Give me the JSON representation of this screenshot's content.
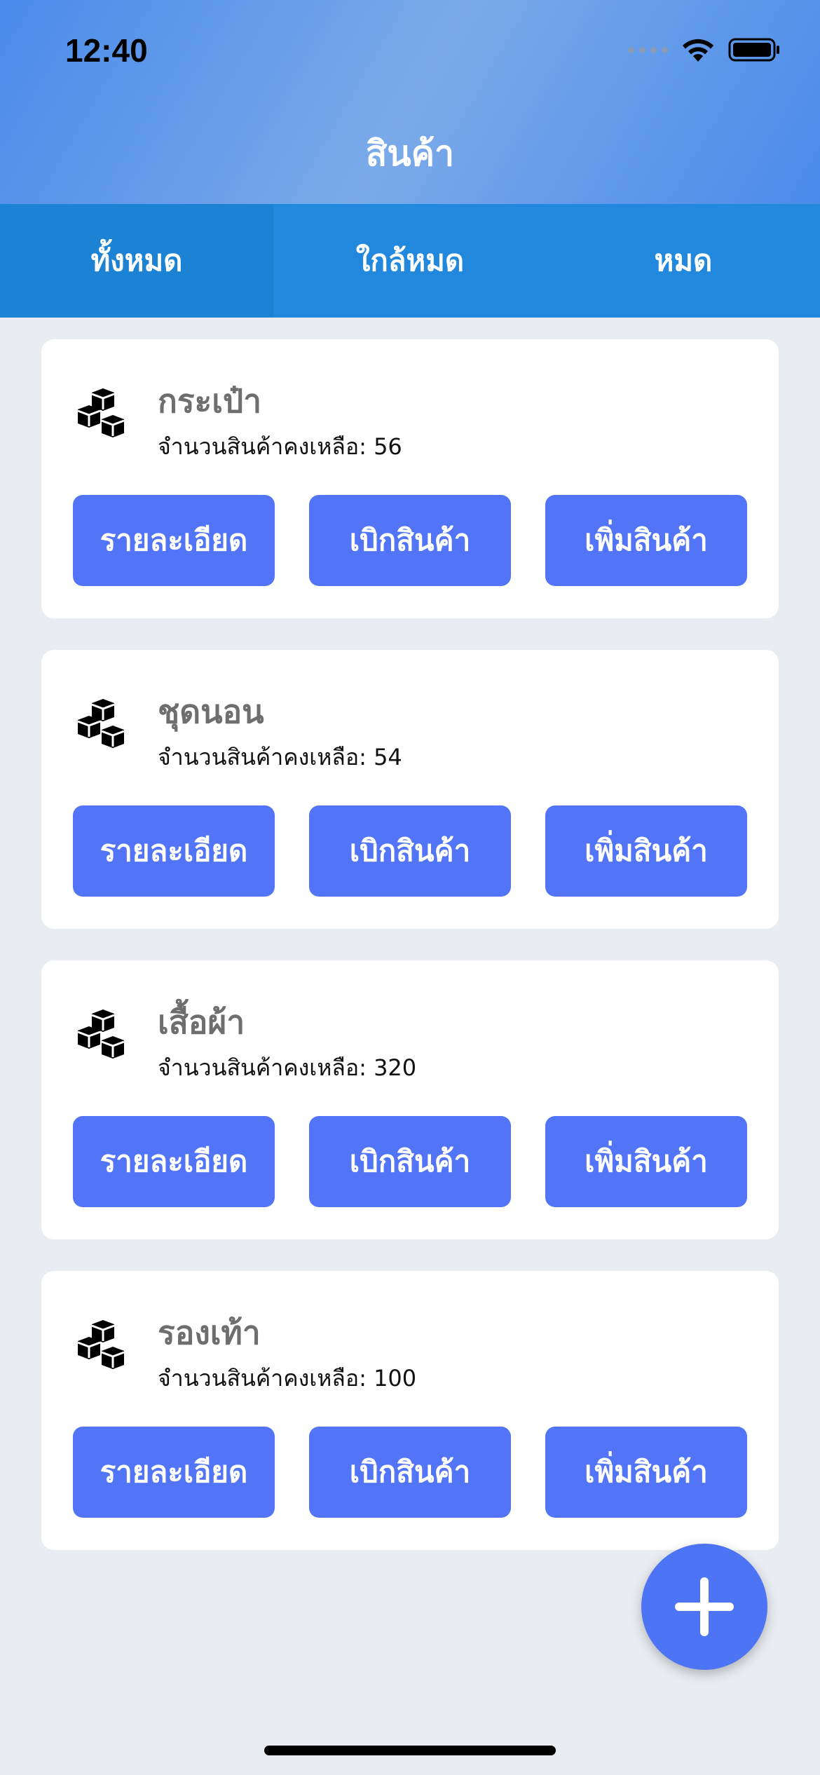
{
  "status_bar": {
    "time": "12:40"
  },
  "header": {
    "title": "สินค้า"
  },
  "tabs": [
    {
      "label": "ทั้งหมด",
      "active": true
    },
    {
      "label": "ใกล้หมด",
      "active": false
    },
    {
      "label": "หมด",
      "active": false
    }
  ],
  "products": [
    {
      "name": "กระเป๋า",
      "stock": "จำนวนสินค้าคงเหลือ: 56",
      "icon": "boxes-icon"
    },
    {
      "name": "ชุดนอน",
      "stock": "จำนวนสินค้าคงเหลือ: 54",
      "icon": "boxes-icon"
    },
    {
      "name": "เสื้อผ้า",
      "stock": "จำนวนสินค้าคงเหลือ: 320",
      "icon": "boxes-icon"
    },
    {
      "name": "รองเท้า",
      "stock": "จำนวนสินค้าคงเหลือ: 100",
      "icon": "boxes-icon"
    }
  ],
  "actions": {
    "details": "รายละเอียด",
    "withdraw": "เบิกสินค้า",
    "add_stock": "เพิ่มสินค้า"
  },
  "fab": {
    "icon": "plus-icon"
  },
  "colors": {
    "header": "#4A8BEA",
    "tabs": "#2188DE",
    "button": "#5274F7",
    "background": "#E9EDF2"
  }
}
